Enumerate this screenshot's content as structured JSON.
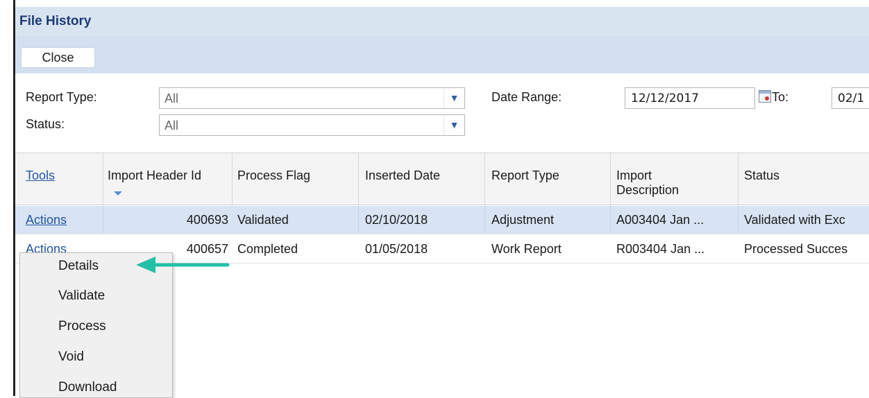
{
  "window": {
    "title": "File History"
  },
  "toolbar": {
    "close_label": "Close"
  },
  "filters": {
    "report_type_label": "Report Type:",
    "report_type_value": "All",
    "status_label": "Status:",
    "status_value": "All",
    "date_range_label": "Date Range:",
    "date_from": "12/12/2017",
    "to_label": "To:",
    "date_to": "02/1"
  },
  "grid": {
    "headers": {
      "tools": "Tools",
      "import_header_id": "Import Header Id",
      "process_flag": "Process Flag",
      "inserted_date": "Inserted Date",
      "report_type": "Report Type",
      "import_description_1": "Import",
      "import_description_2": "Description",
      "status": "Status"
    },
    "rows": [
      {
        "tools": "Actions",
        "import_header_id": "400693",
        "process_flag": "Validated",
        "inserted_date": "02/10/2018",
        "report_type": "Adjustment",
        "import_description": "A003404 Jan ...",
        "status": "Validated with Exc"
      },
      {
        "tools": "Actions",
        "import_header_id": "400657",
        "process_flag": "Completed",
        "inserted_date": "01/05/2018",
        "report_type": "Work Report",
        "import_description": "R003404 Jan ...",
        "status": "Processed Succes"
      }
    ]
  },
  "context_menu": {
    "items": [
      "Details",
      "Validate",
      "Process",
      "Void",
      "Download"
    ]
  },
  "colors": {
    "title": "#1d3a75",
    "header_bg": "#d9e4f1",
    "link": "#2255a4",
    "arrow": "#23c0a8"
  },
  "icons": {
    "dropdown": "chevron-down-icon",
    "calendar": "calendar-icon",
    "sort": "sort-arrow-icon",
    "pointer": "arrow-icon"
  }
}
